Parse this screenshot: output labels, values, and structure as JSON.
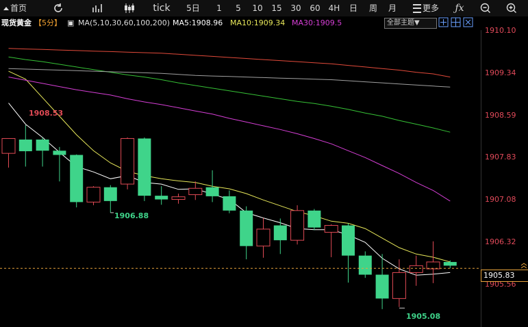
{
  "toolbar": {
    "home_label": "首页",
    "tabs": [
      "tick",
      "5日",
      "1",
      "5",
      "10",
      "15",
      "30",
      "60",
      "4H",
      "日",
      "周",
      "月"
    ],
    "more_label": "更多"
  },
  "info": {
    "instrument": "现货黄金",
    "period": "【5分】",
    "ma_params": "MA(5,10,30,60,100,200)",
    "ma5": "MA5:1908.96",
    "ma10": "MA10:1909.34",
    "ma30": "MA30:1909.5",
    "theme_select": "全部主题▼"
  },
  "price_axis": {
    "ticks": [
      "1910.10",
      "1909.34",
      "1908.59",
      "1907.83",
      "1907.08",
      "1906.32",
      "1905.56"
    ],
    "current": "1905.83"
  },
  "markers": {
    "high_label": "1908.53",
    "low1_label": "1906.88",
    "low2_label": "1905.08"
  },
  "colors": {
    "up": "#e14a55",
    "down": "#3fd48a",
    "ma5": "#ffffff",
    "ma10": "#e8e85a",
    "ma30": "#d63fd6",
    "ma60": "#36c236",
    "ma100": "#a0a0a0",
    "ma200": "#e24a3a",
    "price_tick": "#e24a5a",
    "current_line": "#e9a43c"
  },
  "chart_data": {
    "type": "candlestick",
    "y_range": [
      1904.8,
      1910.3
    ],
    "candles": [
      {
        "o": 1908.0,
        "h": 1908.28,
        "l": 1907.73,
        "c": 1908.28
      },
      {
        "o": 1908.26,
        "h": 1908.53,
        "l": 1907.75,
        "c": 1908.04
      },
      {
        "o": 1908.26,
        "h": 1908.3,
        "l": 1907.75,
        "c": 1908.05
      },
      {
        "o": 1908.05,
        "h": 1908.12,
        "l": 1907.47,
        "c": 1907.97
      },
      {
        "o": 1907.97,
        "h": 1907.98,
        "l": 1906.98,
        "c": 1907.08
      },
      {
        "o": 1907.08,
        "h": 1907.38,
        "l": 1907.02,
        "c": 1907.36
      },
      {
        "o": 1907.36,
        "h": 1907.4,
        "l": 1906.88,
        "c": 1907.1
      },
      {
        "o": 1907.42,
        "h": 1908.3,
        "l": 1907.32,
        "c": 1908.28
      },
      {
        "o": 1908.28,
        "h": 1908.3,
        "l": 1907.1,
        "c": 1907.2
      },
      {
        "o": 1907.2,
        "h": 1907.38,
        "l": 1907.03,
        "c": 1907.13
      },
      {
        "o": 1907.13,
        "h": 1907.24,
        "l": 1907.05,
        "c": 1907.18
      },
      {
        "o": 1907.22,
        "h": 1907.47,
        "l": 1907.12,
        "c": 1907.34
      },
      {
        "o": 1907.36,
        "h": 1907.68,
        "l": 1907.08,
        "c": 1907.19
      },
      {
        "o": 1907.19,
        "h": 1907.3,
        "l": 1906.87,
        "c": 1906.92
      },
      {
        "o": 1906.92,
        "h": 1907.0,
        "l": 1906.0,
        "c": 1906.25
      },
      {
        "o": 1906.25,
        "h": 1906.78,
        "l": 1906.03,
        "c": 1906.57
      },
      {
        "o": 1906.64,
        "h": 1906.77,
        "l": 1906.1,
        "c": 1906.36
      },
      {
        "o": 1906.36,
        "h": 1907.02,
        "l": 1906.28,
        "c": 1906.92
      },
      {
        "o": 1906.92,
        "h": 1906.95,
        "l": 1906.55,
        "c": 1906.6
      },
      {
        "o": 1906.51,
        "h": 1906.66,
        "l": 1906.04,
        "c": 1906.64
      },
      {
        "o": 1906.64,
        "h": 1906.68,
        "l": 1905.56,
        "c": 1906.07
      },
      {
        "o": 1906.07,
        "h": 1906.15,
        "l": 1905.65,
        "c": 1905.71
      },
      {
        "o": 1905.71,
        "h": 1906.1,
        "l": 1905.06,
        "c": 1905.26
      },
      {
        "o": 1905.26,
        "h": 1906.0,
        "l": 1905.1,
        "c": 1905.75
      },
      {
        "o": 1905.75,
        "h": 1906.07,
        "l": 1905.5,
        "c": 1905.88
      },
      {
        "o": 1905.82,
        "h": 1906.34,
        "l": 1905.55,
        "c": 1905.95
      },
      {
        "o": 1905.95,
        "h": 1905.98,
        "l": 1905.83,
        "c": 1905.88
      }
    ],
    "ma": [
      {
        "name": "MA5",
        "colorKey": "ma5",
        "start": 0,
        "values": [
          1908.95,
          1908.55,
          1908.3,
          1908.02,
          1907.75,
          1907.65,
          1907.52,
          1907.58,
          1907.45,
          1907.42,
          1907.32,
          1907.33,
          1907.23,
          1907.13,
          1906.88,
          1906.78,
          1906.69,
          1906.58,
          1906.56,
          1906.56,
          1906.46,
          1906.32,
          1906.02,
          1905.82,
          1905.7,
          1905.72,
          1905.75
        ]
      },
      {
        "name": "MA10",
        "colorKey": "ma10",
        "start": 0,
        "values": [
          1909.55,
          1909.4,
          1909.05,
          1908.7,
          1908.35,
          1908.05,
          1907.82,
          1907.66,
          1907.58,
          1907.52,
          1907.48,
          1907.45,
          1907.38,
          1907.33,
          1907.24,
          1907.12,
          1907.01,
          1906.9,
          1906.82,
          1906.72,
          1906.68,
          1906.58,
          1906.4,
          1906.22,
          1906.1,
          1906.04,
          1905.95
        ]
      },
      {
        "name": "MA30",
        "colorKey": "ma30",
        "start": 0,
        "values": [
          1909.44,
          1909.38,
          1909.32,
          1909.26,
          1909.2,
          1909.15,
          1909.1,
          1909.03,
          1908.97,
          1908.92,
          1908.86,
          1908.8,
          1908.74,
          1908.66,
          1908.59,
          1908.52,
          1908.45,
          1908.37,
          1908.28,
          1908.18,
          1908.05,
          1907.92,
          1907.77,
          1907.62,
          1907.45,
          1907.3,
          1907.1
        ]
      },
      {
        "name": "MA60",
        "colorKey": "ma60",
        "start": 0,
        "values": [
          1909.82,
          1909.77,
          1909.73,
          1909.68,
          1909.63,
          1909.58,
          1909.53,
          1909.48,
          1909.44,
          1909.39,
          1909.33,
          1909.28,
          1909.23,
          1909.18,
          1909.13,
          1909.08,
          1909.03,
          1908.98,
          1908.94,
          1908.89,
          1908.83,
          1908.76,
          1908.7,
          1908.62,
          1908.55,
          1908.48,
          1908.4
        ]
      },
      {
        "name": "MA100",
        "colorKey": "ma100",
        "start": 0,
        "values": [
          1909.6,
          1909.59,
          1909.58,
          1909.57,
          1909.56,
          1909.55,
          1909.54,
          1909.53,
          1909.52,
          1909.51,
          1909.49,
          1909.47,
          1909.46,
          1909.45,
          1909.44,
          1909.43,
          1909.42,
          1909.41,
          1909.4,
          1909.39,
          1909.37,
          1909.35,
          1909.33,
          1909.31,
          1909.29,
          1909.27,
          1909.25
        ]
      },
      {
        "name": "MA200",
        "colorKey": "ma200",
        "start": 0,
        "values": [
          1909.98,
          1909.97,
          1909.96,
          1909.95,
          1909.94,
          1909.93,
          1909.92,
          1909.91,
          1909.9,
          1909.89,
          1909.87,
          1909.85,
          1909.83,
          1909.81,
          1909.79,
          1909.77,
          1909.75,
          1909.73,
          1909.71,
          1909.69,
          1909.66,
          1909.63,
          1909.6,
          1909.57,
          1909.53,
          1909.5,
          1909.44
        ]
      }
    ]
  }
}
